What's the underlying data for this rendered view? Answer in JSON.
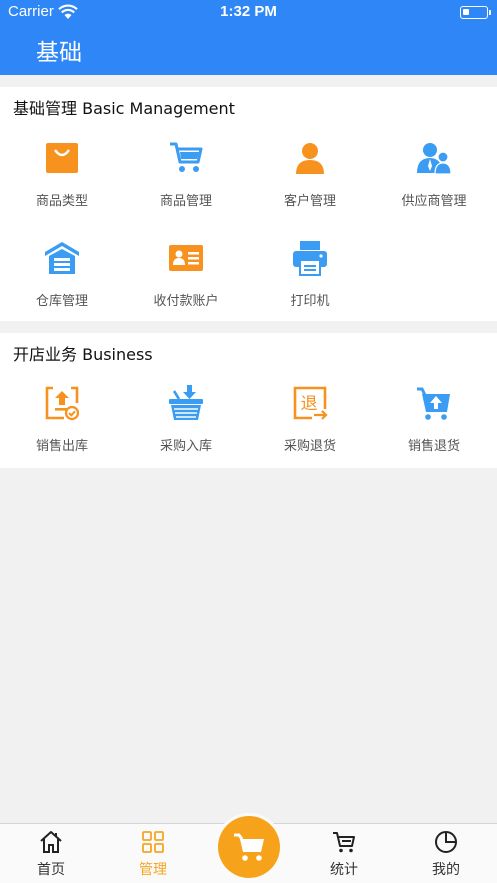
{
  "status_bar": {
    "carrier": "Carrier",
    "time": "1:32 PM"
  },
  "nav": {
    "title": "基础"
  },
  "sections": [
    {
      "title": "基础管理 Basic Management",
      "items": [
        {
          "label": "商品类型",
          "icon": "shopping-bag-icon"
        },
        {
          "label": "商品管理",
          "icon": "cart-icon"
        },
        {
          "label": "客户管理",
          "icon": "person-icon"
        },
        {
          "label": "供应商管理",
          "icon": "people-icon"
        },
        {
          "label": "仓库管理",
          "icon": "warehouse-icon"
        },
        {
          "label": "收付款账户",
          "icon": "id-card-icon"
        },
        {
          "label": "打印机",
          "icon": "printer-icon"
        }
      ]
    },
    {
      "title": "开店业务 Business",
      "items": [
        {
          "label": "销售出库",
          "icon": "stock-out-icon"
        },
        {
          "label": "采购入库",
          "icon": "basket-in-icon"
        },
        {
          "label": "采购退货",
          "icon": "return-doc-icon",
          "glyph": "退"
        },
        {
          "label": "销售退货",
          "icon": "cart-return-icon"
        }
      ]
    }
  ],
  "tabbar": {
    "items": [
      {
        "label": "首页",
        "icon": "home-icon"
      },
      {
        "label": "管理",
        "icon": "grid-icon",
        "active": true
      },
      {
        "label": "统计",
        "icon": "cart-outline-icon"
      },
      {
        "label": "我的",
        "icon": "pie-chart-icon"
      }
    ],
    "center_icon": "cart-icon"
  },
  "colors": {
    "primary": "#2f86f6",
    "accent_orange": "#f7a21b",
    "icon_blue": "#3a9cf2"
  }
}
